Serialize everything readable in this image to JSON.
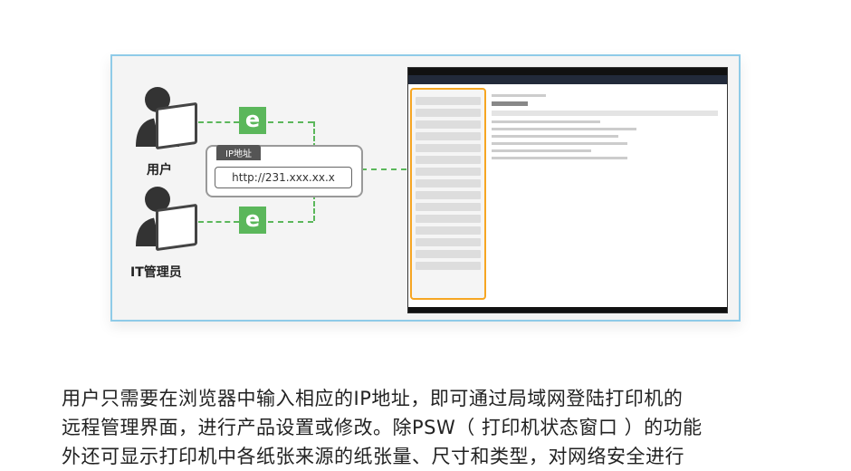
{
  "figure": {
    "user_label": "用户",
    "admin_label": "IT管理员",
    "badge_letter": "e",
    "ip_tag": "IP地址",
    "ip_value": "http://231.xxx.xx.x",
    "colors": {
      "accent_green": "#5bb75b",
      "frame_blue": "#8fcbe8",
      "sidebar_orange": "#f6a623"
    }
  },
  "paragraph": {
    "line1": "用户只需要在浏览器中输入相应的IP地址，即可通过局域网登陆打印机的",
    "line2": "远程管理界面，进行产品设置或修改。除PSW（ 打印机状态窗口 ）的功能",
    "line3": "外还可显示打印机中各纸张来源的纸张量、尺寸和类型，对网络安全进行"
  }
}
